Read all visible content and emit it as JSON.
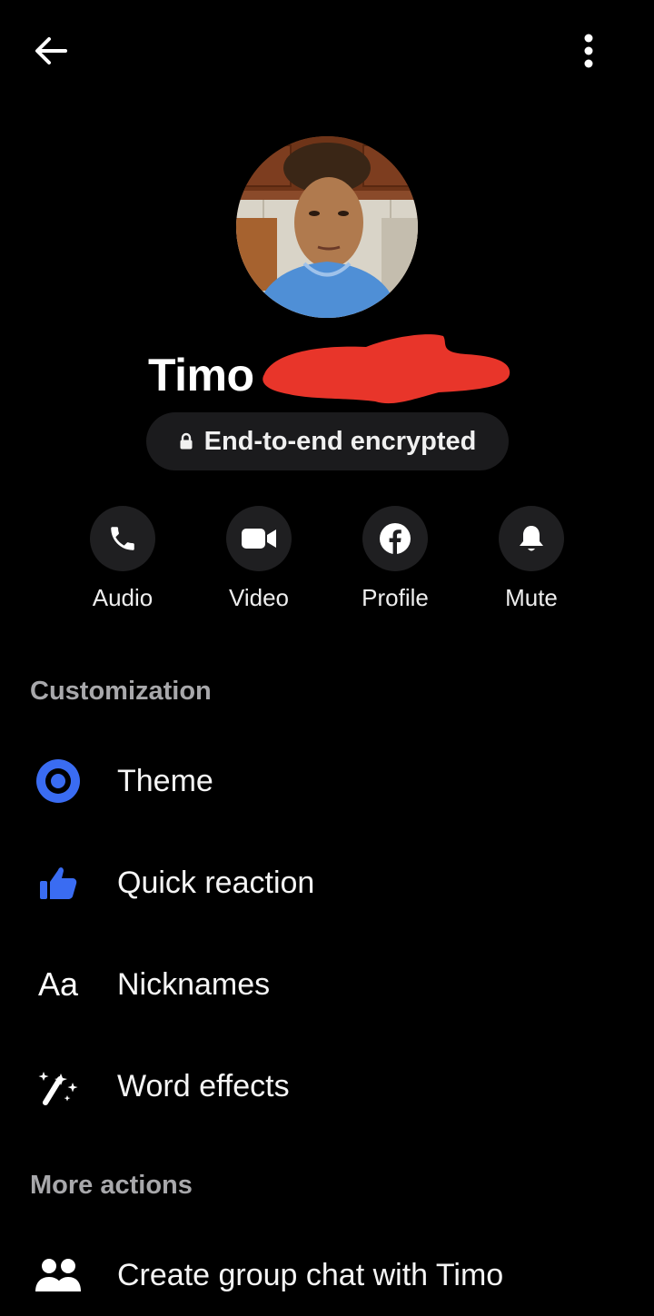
{
  "header": {
    "back_icon": "arrow-left-icon",
    "menu_icon": "more-vertical-icon"
  },
  "profile": {
    "name": "Timo",
    "encryption_label": "End-to-end encrypted",
    "encryption_icon": "lock-icon"
  },
  "actions": [
    {
      "label": "Audio",
      "icon": "phone-icon"
    },
    {
      "label": "Video",
      "icon": "video-camera-icon"
    },
    {
      "label": "Profile",
      "icon": "facebook-icon"
    },
    {
      "label": "Mute",
      "icon": "bell-icon"
    }
  ],
  "customization": {
    "title": "Customization",
    "items": [
      {
        "label": "Theme",
        "icon": "theme-icon"
      },
      {
        "label": "Quick reaction",
        "icon": "thumbs-up-icon"
      },
      {
        "label": "Nicknames",
        "icon": "aa-text-icon",
        "icon_text": "Aa"
      },
      {
        "label": "Word effects",
        "icon": "magic-wand-icon"
      }
    ]
  },
  "more_actions": {
    "title": "More actions",
    "items": [
      {
        "label": "Create group chat with Timo",
        "icon": "group-icon"
      }
    ]
  },
  "colors": {
    "background": "#000000",
    "accent": "#3a6cf2",
    "pill": "#1b1b1d",
    "action_circle": "#1f1f21",
    "section_title": "#a8a8ab",
    "redaction": "#e8352a"
  }
}
